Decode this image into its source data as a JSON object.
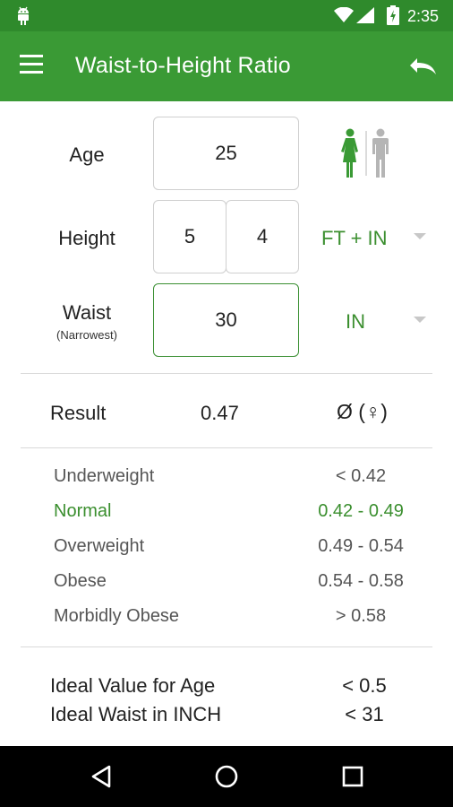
{
  "status_bar": {
    "time": "2:35"
  },
  "app_bar": {
    "title": "Waist-to-Height Ratio"
  },
  "form": {
    "age": {
      "label": "Age",
      "value": "25"
    },
    "height": {
      "label": "Height",
      "feet": "5",
      "inches": "4",
      "unit": "FT + IN"
    },
    "waist": {
      "label": "Waist",
      "sublabel": "(Narrowest)",
      "value": "30",
      "unit": "IN"
    }
  },
  "result": {
    "label": "Result",
    "value": "0.47",
    "symbol": "Ø (♀)"
  },
  "ranges": [
    {
      "category": "Underweight",
      "range": "< 0.42"
    },
    {
      "category": "Normal",
      "range": "0.42 - 0.49",
      "highlight": true
    },
    {
      "category": "Overweight",
      "range": "0.49 - 0.54"
    },
    {
      "category": "Obese",
      "range": "0.54 - 0.58"
    },
    {
      "category": "Morbidly Obese",
      "range": "> 0.58"
    }
  ],
  "ideal": {
    "age_label": "Ideal Value for Age",
    "age_value": "< 0.5",
    "waist_label": "Ideal Waist in INCH",
    "waist_value": "< 31"
  },
  "colors": {
    "status_bar": "#2f8a2c",
    "app_bar": "#3a9a35",
    "accent": "#3b8f2f",
    "female_icon_active": "#3a9a35",
    "male_icon_inactive": "#b5b5b5"
  }
}
